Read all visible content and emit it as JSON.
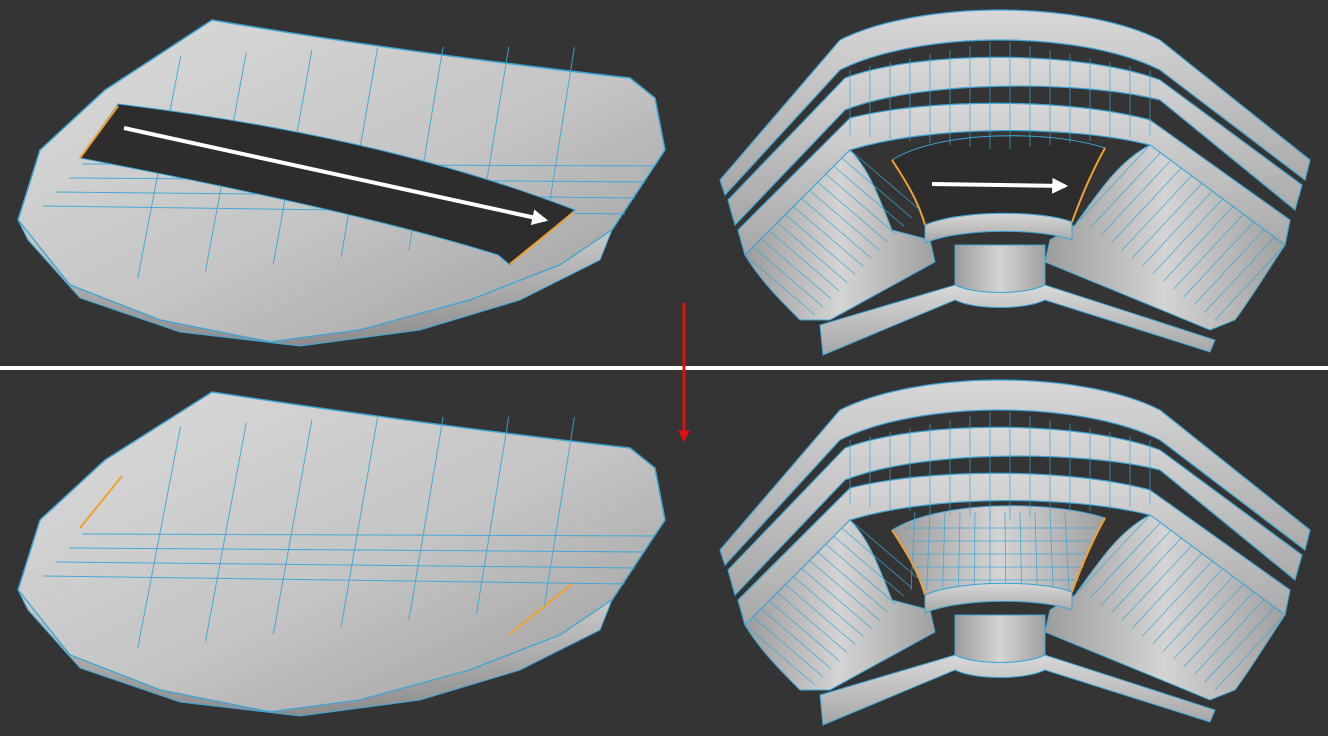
{
  "colors": {
    "background": "#343434",
    "surface": "#bfbfbf",
    "surface_light": "#d6d6d6",
    "surface_shadow": "#8a8a8a",
    "wire": "#3aa6d6",
    "selected_edge": "#f0a030",
    "hole": "#2d2d2d",
    "divider": "#ffffff",
    "direction_arrow": "#ffffff",
    "result_arrow": "#e01010"
  },
  "icons": {
    "direction_arrow": "arrow-right-icon",
    "result_arrow": "arrow-down-icon"
  },
  "panels": [
    {
      "name": "hood-before",
      "state": "before"
    },
    {
      "name": "molding-before",
      "state": "before"
    },
    {
      "name": "hood-after",
      "state": "after"
    },
    {
      "name": "molding-after",
      "state": "after"
    }
  ]
}
